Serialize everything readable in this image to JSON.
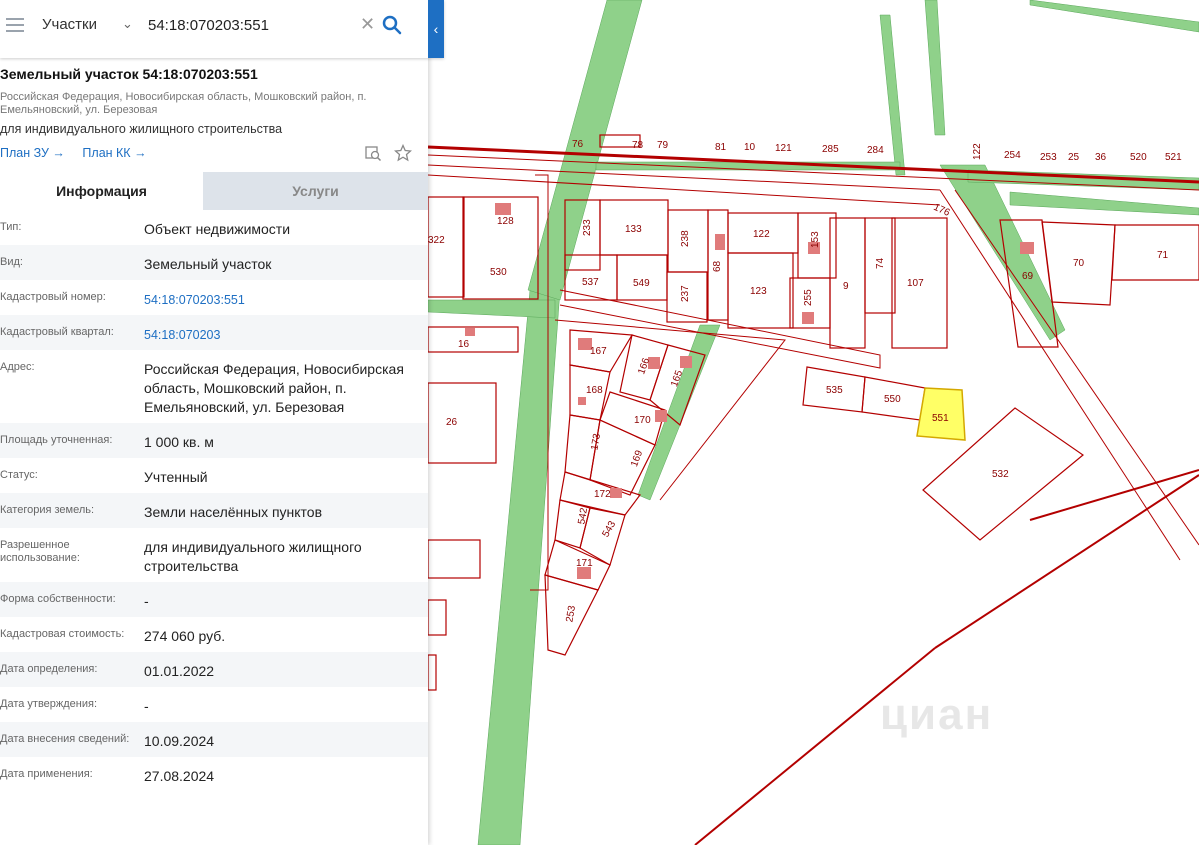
{
  "search": {
    "layer": "Участки",
    "query": "54:18:070203:551"
  },
  "object": {
    "title": "Земельный участок 54:18:070203:551",
    "address_short": "Российская Федерация, Новосибирская область, Мошковский район, п. Емельяновский, ул. Березовая",
    "purpose": "для индивидуального жилищного строительства",
    "plan_zu": "План ЗУ →",
    "plan_kk": "План КК →"
  },
  "tabs": [
    {
      "label": "Информация"
    },
    {
      "label": "Услуги"
    }
  ],
  "rows": [
    {
      "k": "Тип:",
      "v": "Объект недвижимости"
    },
    {
      "k": "Вид:",
      "v": "Земельный участок"
    },
    {
      "k": "Кадастровый номер:",
      "v": "54:18:070203:551"
    },
    {
      "k": "Кадастровый квартал:",
      "v": "54:18:070203"
    },
    {
      "k": "Адрес:",
      "v": "Российская Федерация, Новосибирская область, Мошковский район, п. Емельяновский, ул. Березовая"
    },
    {
      "k": "Площадь уточненная:",
      "v": "1 000 кв. м"
    },
    {
      "k": "Статус:",
      "v": "Учтенный"
    },
    {
      "k": "Категория земель:",
      "v": "Земли населённых пунктов"
    },
    {
      "k": "Разрешенное использование:",
      "v": "для индивидуального жилищного строительства"
    },
    {
      "k": "Форма собственности:",
      "v": "-"
    },
    {
      "k": "Кадастровая стоимость:",
      "v": "274 060 руб."
    },
    {
      "k": "Дата определения:",
      "v": "01.01.2022"
    },
    {
      "k": "Дата утверждения:",
      "v": "-"
    },
    {
      "k": "Дата внесения сведений:",
      "v": "10.09.2024"
    },
    {
      "k": "Дата применения:",
      "v": "27.08.2024"
    }
  ],
  "map": {
    "parcel_labels": [
      "76",
      "78",
      "79",
      "81",
      "10",
      "121",
      "285",
      "284",
      "122",
      "254",
      "253",
      "25",
      "36",
      "520",
      "521",
      "128",
      "322",
      "233",
      "133",
      "238",
      "68",
      "122",
      "153",
      "530",
      "537",
      "549",
      "237",
      "123",
      "255",
      "9",
      "74",
      "107",
      "69",
      "70",
      "71",
      "16",
      "167",
      "166",
      "165",
      "168",
      "170",
      "535",
      "550",
      "551",
      "26",
      "173",
      "169",
      "532",
      "172",
      "542",
      "543",
      "171",
      "253",
      "176"
    ],
    "selected_parcel": "551",
    "watermark": "циан"
  },
  "colors": {
    "accent": "#1e6fc3",
    "parcel_line": "#b30000",
    "road_green": "#8fd18a",
    "selected": "#ffff66"
  }
}
